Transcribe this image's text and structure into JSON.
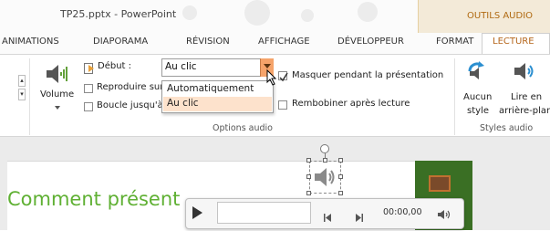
{
  "window": {
    "title": "TP25.pptx - PowerPoint",
    "context_label": "OUTILS AUDIO"
  },
  "tabs": [
    {
      "label": "ANIMATIONS"
    },
    {
      "label": "DIAPORAMA"
    },
    {
      "label": "RÉVISION"
    },
    {
      "label": "AFFICHAGE"
    },
    {
      "label": "DÉVELOPPEUR"
    },
    {
      "label": "FORMAT"
    },
    {
      "label": "LECTURE",
      "active": true
    }
  ],
  "ribbon": {
    "volume_label": "Volume",
    "start_label": "Début :",
    "start_value": "Au clic",
    "start_options": [
      "Automatiquement",
      "Au clic"
    ],
    "loop_options": {
      "play_across": "Reproduire sur",
      "loop": "Boucle jusqu'à"
    },
    "hide_during": "Masquer pendant la présentation",
    "rewind": "Rembobiner après lecture",
    "group_options": "Options audio",
    "style_none_line1": "Aucun",
    "style_none_line2": "style",
    "style_bg_line1": "Lire en",
    "style_bg_line2": "arrière-plan",
    "group_styles": "Styles audio"
  },
  "slide": {
    "text": "Comment présent"
  },
  "player": {
    "time": "00:00,00"
  },
  "colors": {
    "accent": "#b5661b",
    "combo_button": "#f5a36a",
    "selected_option": "#fde2cc",
    "slide_text": "#5fb033",
    "context_header": "#f3ead8"
  }
}
